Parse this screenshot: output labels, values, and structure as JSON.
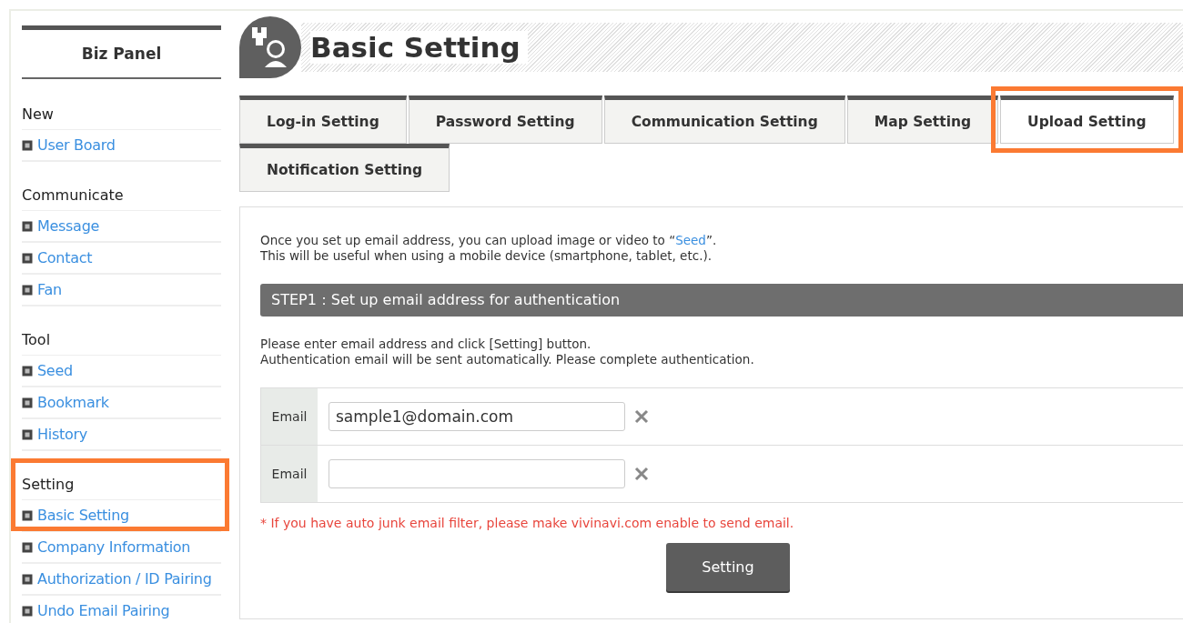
{
  "sidebar": {
    "title": "Biz Panel",
    "sections": [
      {
        "heading": "New",
        "highlighted": false,
        "items": [
          {
            "label": "User Board"
          }
        ]
      },
      {
        "heading": "Communicate",
        "highlighted": false,
        "items": [
          {
            "label": "Message"
          },
          {
            "label": "Contact"
          },
          {
            "label": "Fan"
          }
        ]
      },
      {
        "heading": "Tool",
        "highlighted": false,
        "items": [
          {
            "label": "Seed"
          },
          {
            "label": "Bookmark"
          },
          {
            "label": "History"
          }
        ]
      },
      {
        "heading": "Setting",
        "highlighted": true,
        "items": [
          {
            "label": "Basic Setting"
          },
          {
            "label": "Company Information"
          },
          {
            "label": "Authorization / ID Pairing"
          },
          {
            "label": "Undo Email Pairing"
          }
        ]
      }
    ]
  },
  "header": {
    "title": "Basic Setting"
  },
  "tabs": [
    {
      "label": "Log-in Setting",
      "selected": false,
      "highlighted": false
    },
    {
      "label": "Password Setting",
      "selected": false,
      "highlighted": false
    },
    {
      "label": "Communication Setting",
      "selected": false,
      "highlighted": false
    },
    {
      "label": "Map Setting",
      "selected": false,
      "highlighted": false
    },
    {
      "label": "Upload Setting",
      "selected": true,
      "highlighted": true
    },
    {
      "label": "Notification Setting",
      "selected": false,
      "highlighted": false
    }
  ],
  "intro": {
    "before": "Once you set up email address, you can upload image or video to “",
    "link": "Seed",
    "after": "”.",
    "line2": "This will be useful when using a mobile device (smartphone, tablet, etc.)."
  },
  "step": {
    "title": "STEP1：Set up email address for authentication"
  },
  "instructions": [
    "Please enter email address and click [Setting] button.",
    "Authentication email will be sent automatically. Please complete authentication."
  ],
  "email_fields": [
    {
      "label": "Email",
      "value": "sample1@domain.com"
    },
    {
      "label": "Email"
    }
  ],
  "note": "* If you have auto junk email filter, please make vivinavi.com enable to send email.",
  "button": "Setting"
}
